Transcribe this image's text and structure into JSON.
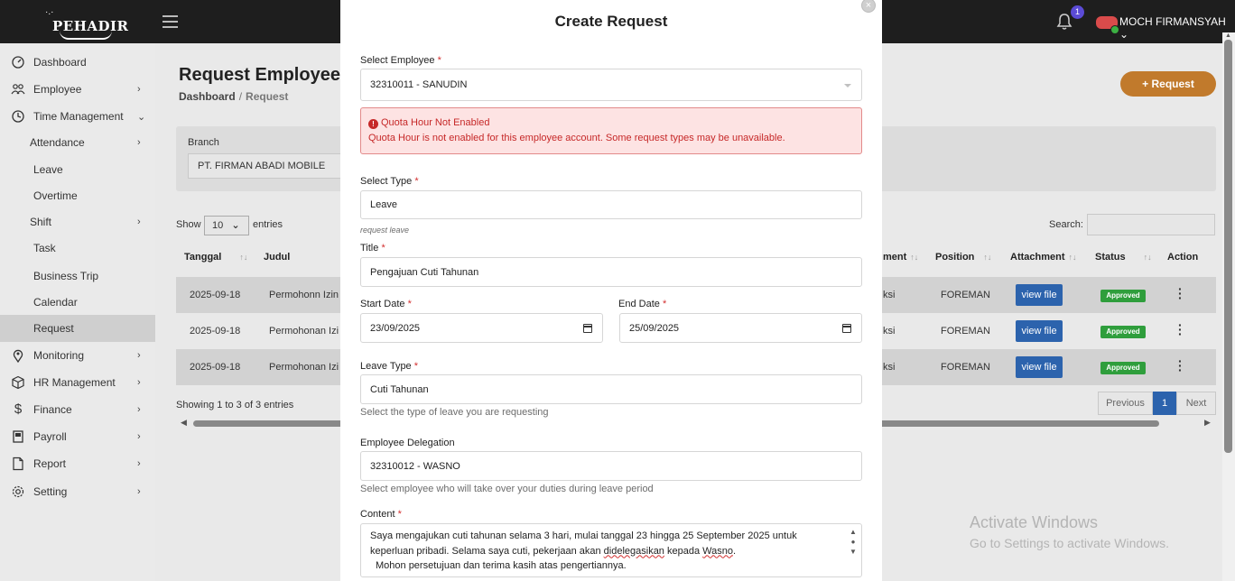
{
  "app": {
    "brand": "PEHADIR"
  },
  "header": {
    "notification_count": "1",
    "user_name": "MOCH FIRMANSYAH"
  },
  "sidebar": {
    "items": [
      {
        "label": "Dashboard",
        "icon": "gauge-icon"
      },
      {
        "label": "Employee",
        "icon": "people-icon"
      },
      {
        "label": "Time Management",
        "icon": "clock-icon"
      },
      {
        "label": "Attendance"
      },
      {
        "label": "Leave"
      },
      {
        "label": "Overtime"
      },
      {
        "label": "Shift"
      },
      {
        "label": "Task"
      },
      {
        "label": "Business Trip"
      },
      {
        "label": "Calendar"
      },
      {
        "label": "Request"
      },
      {
        "label": "Monitoring",
        "icon": "location-pin-icon"
      },
      {
        "label": "HR Management",
        "icon": "cube-icon"
      },
      {
        "label": "Finance",
        "icon": "dollar-icon"
      },
      {
        "label": "Payroll",
        "icon": "payroll-icon"
      },
      {
        "label": "Report",
        "icon": "document-icon"
      },
      {
        "label": "Setting",
        "icon": "gear-icon"
      }
    ]
  },
  "page": {
    "title": "Request Employee",
    "breadcrumb_home": "Dashboard",
    "breadcrumb_sep": "/",
    "breadcrumb_current": "Request",
    "add_button": "+ Request",
    "branch_label": "Branch",
    "branch_value": "PT. FIRMAN ABADI MOBILE",
    "show_label": "Show",
    "entries_value": "10",
    "entries_label": "entries",
    "search_label": "Search:",
    "showing_text": "Showing 1 to 3 of 3 entries",
    "pager": {
      "previous": "Previous",
      "current": "1",
      "next": "Next"
    }
  },
  "table": {
    "headers": {
      "tanggal": "Tanggal",
      "judul": "Judul",
      "department": "ment",
      "position": "Position",
      "attachment": "Attachment",
      "status": "Status",
      "action": "Action"
    },
    "rows": [
      {
        "tanggal": "2025-09-18",
        "judul": "Permohonn Izin",
        "department": "ksi",
        "position": "FOREMAN",
        "attachment": "view file",
        "status": "Approved"
      },
      {
        "tanggal": "2025-09-18",
        "judul": "Permohonan Izi",
        "department": "ksi",
        "position": "FOREMAN",
        "attachment": "view file",
        "status": "Approved"
      },
      {
        "tanggal": "2025-09-18",
        "judul": "Permohonan Izi",
        "department": "ksi",
        "position": "FOREMAN",
        "attachment": "view file",
        "status": "Approved"
      }
    ]
  },
  "modal": {
    "title": "Create Request",
    "employee_label": "Select Employee",
    "employee_value": "32310011 - SANUDIN",
    "alert_title": "Quota Hour Not Enabled",
    "alert_message": "Quota Hour is not enabled for this employee account. Some request types may be unavailable.",
    "type_label": "Select Type",
    "type_value": "Leave",
    "type_hint": "request leave",
    "title_label": "Title",
    "title_value": "Pengajuan Cuti Tahunan",
    "start_label": "Start Date",
    "start_value": "23/09/2025",
    "end_label": "End Date",
    "end_value": "25/09/2025",
    "leave_type_label": "Leave Type",
    "leave_type_value": "Cuti Tahunan",
    "leave_type_hint": "Select the type of leave you are requesting",
    "delegation_label": "Employee Delegation",
    "delegation_value": "32310012 - WASNO",
    "delegation_hint": "Select employee who will take over your duties during leave period",
    "content_label": "Content",
    "content_line1": "Saya mengajukan cuti tahunan selama 3 hari, mulai tanggal 23 hingga 25 September 2025 untuk",
    "content_line2a": "keperluan pribadi. Selama saya cuti, pekerjaan akan ",
    "content_line2b": "didelegasikan",
    "content_line2c": " kepada ",
    "content_line2d": "Wasno",
    "content_line2e": ".",
    "content_line3": "Mohon persetujuan dan terima kasih atas pengertiannya.",
    "required_mark": "*"
  },
  "watermark": {
    "line1": "Activate Windows",
    "line2": "Go to Settings to activate Windows."
  },
  "colors": {
    "topbar": "#1e1e1e",
    "accent_orange": "#c17a2c",
    "primary_blue": "#2c63ad",
    "approved_green": "#2f9e3c",
    "alert_red": "#c62828"
  }
}
